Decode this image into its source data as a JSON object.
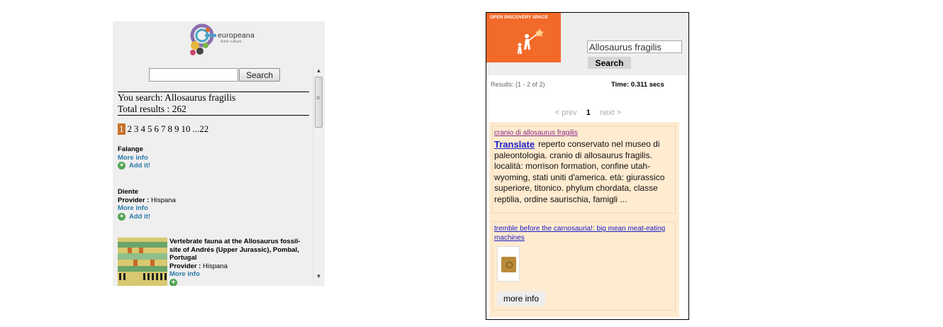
{
  "europeana": {
    "logo_text": "europeana",
    "logo_sub": "think culture",
    "search_value": "",
    "search_button": "Search",
    "you_search": "You search: Allosaurus fragilis",
    "total_results": "Total results : 262",
    "pages": [
      "1",
      "2",
      "3",
      "4",
      "5",
      "6",
      "7",
      "8",
      "9",
      "10",
      "...22"
    ],
    "results": [
      {
        "title": "Falange",
        "provider_label": "",
        "provider": "",
        "more": "More info",
        "add": "Add it!"
      },
      {
        "title": "Diente",
        "provider_label": "Provider :",
        "provider": "Hispana",
        "more": "More info",
        "add": "Add it!"
      },
      {
        "title": "Vertebrate fauna at the Allosaurus fossil-site of Andrés (Upper Jurassic), Pombal, Portugal",
        "provider_label": "Provider :",
        "provider": "Hispana",
        "more": "More info",
        "add": ""
      }
    ]
  },
  "ods": {
    "banner_text": "OPEN DISCOVERY SPACE",
    "query": "Allosaurus fragilis",
    "search_button": "Search",
    "results_text": "Results: (1 - 2 of 2)",
    "time_text": "Time: 0.311 secs",
    "pager": {
      "prev": "< prev",
      "current": "1",
      "next": "next >"
    },
    "items": [
      {
        "title": "cranio di allosaurus fragilis",
        "translate": "Translate",
        "description": "reperto conservato nel museo di paleontologia. cranio di allosaurus fragilis. località: morrison formation, confine utah-wyoming, stati uniti d'america. età: giurassico superiore, titonico. phylum chordata, classe reptilia, ordine saurischia, famigli ..."
      },
      {
        "title": "tremble before the carnosauria!: big mean meat-eating machines",
        "more_info": "more info"
      }
    ]
  },
  "colors": {
    "europeana_bg": "#efefef",
    "page_active": "#c8702a",
    "link_teal": "#2a7aa8",
    "ods_orange": "#f26a2a",
    "ods_panel": "#feebd0"
  }
}
